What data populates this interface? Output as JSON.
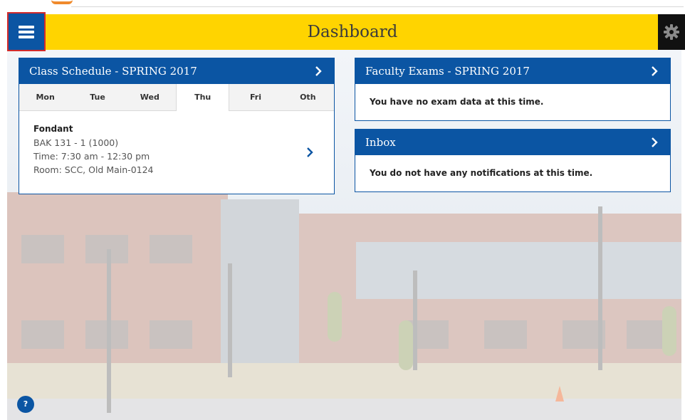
{
  "header": {
    "title": "Dashboard",
    "menu_icon": "hamburger-menu-icon",
    "settings_icon": "gear-icon",
    "accent_color": "#ffd400",
    "brand_color": "#0b55a3"
  },
  "class_schedule": {
    "title": "Class Schedule - SPRING 2017",
    "days": [
      "Mon",
      "Tue",
      "Wed",
      "Thu",
      "Fri",
      "Oth"
    ],
    "selected_day": "Thu",
    "classes": [
      {
        "name": "Fondant",
        "code": "BAK 131 - 1 (1000)",
        "time": "Time: 7:30 am - 12:30 pm",
        "room": "Room: SCC, Old Main-0124"
      }
    ]
  },
  "faculty_exams": {
    "title": "Faculty Exams - SPRING 2017",
    "message": "You have no exam data at this time."
  },
  "inbox": {
    "title": "Inbox",
    "message": "You do not have any notifications at this time."
  },
  "help": {
    "label": "?"
  }
}
